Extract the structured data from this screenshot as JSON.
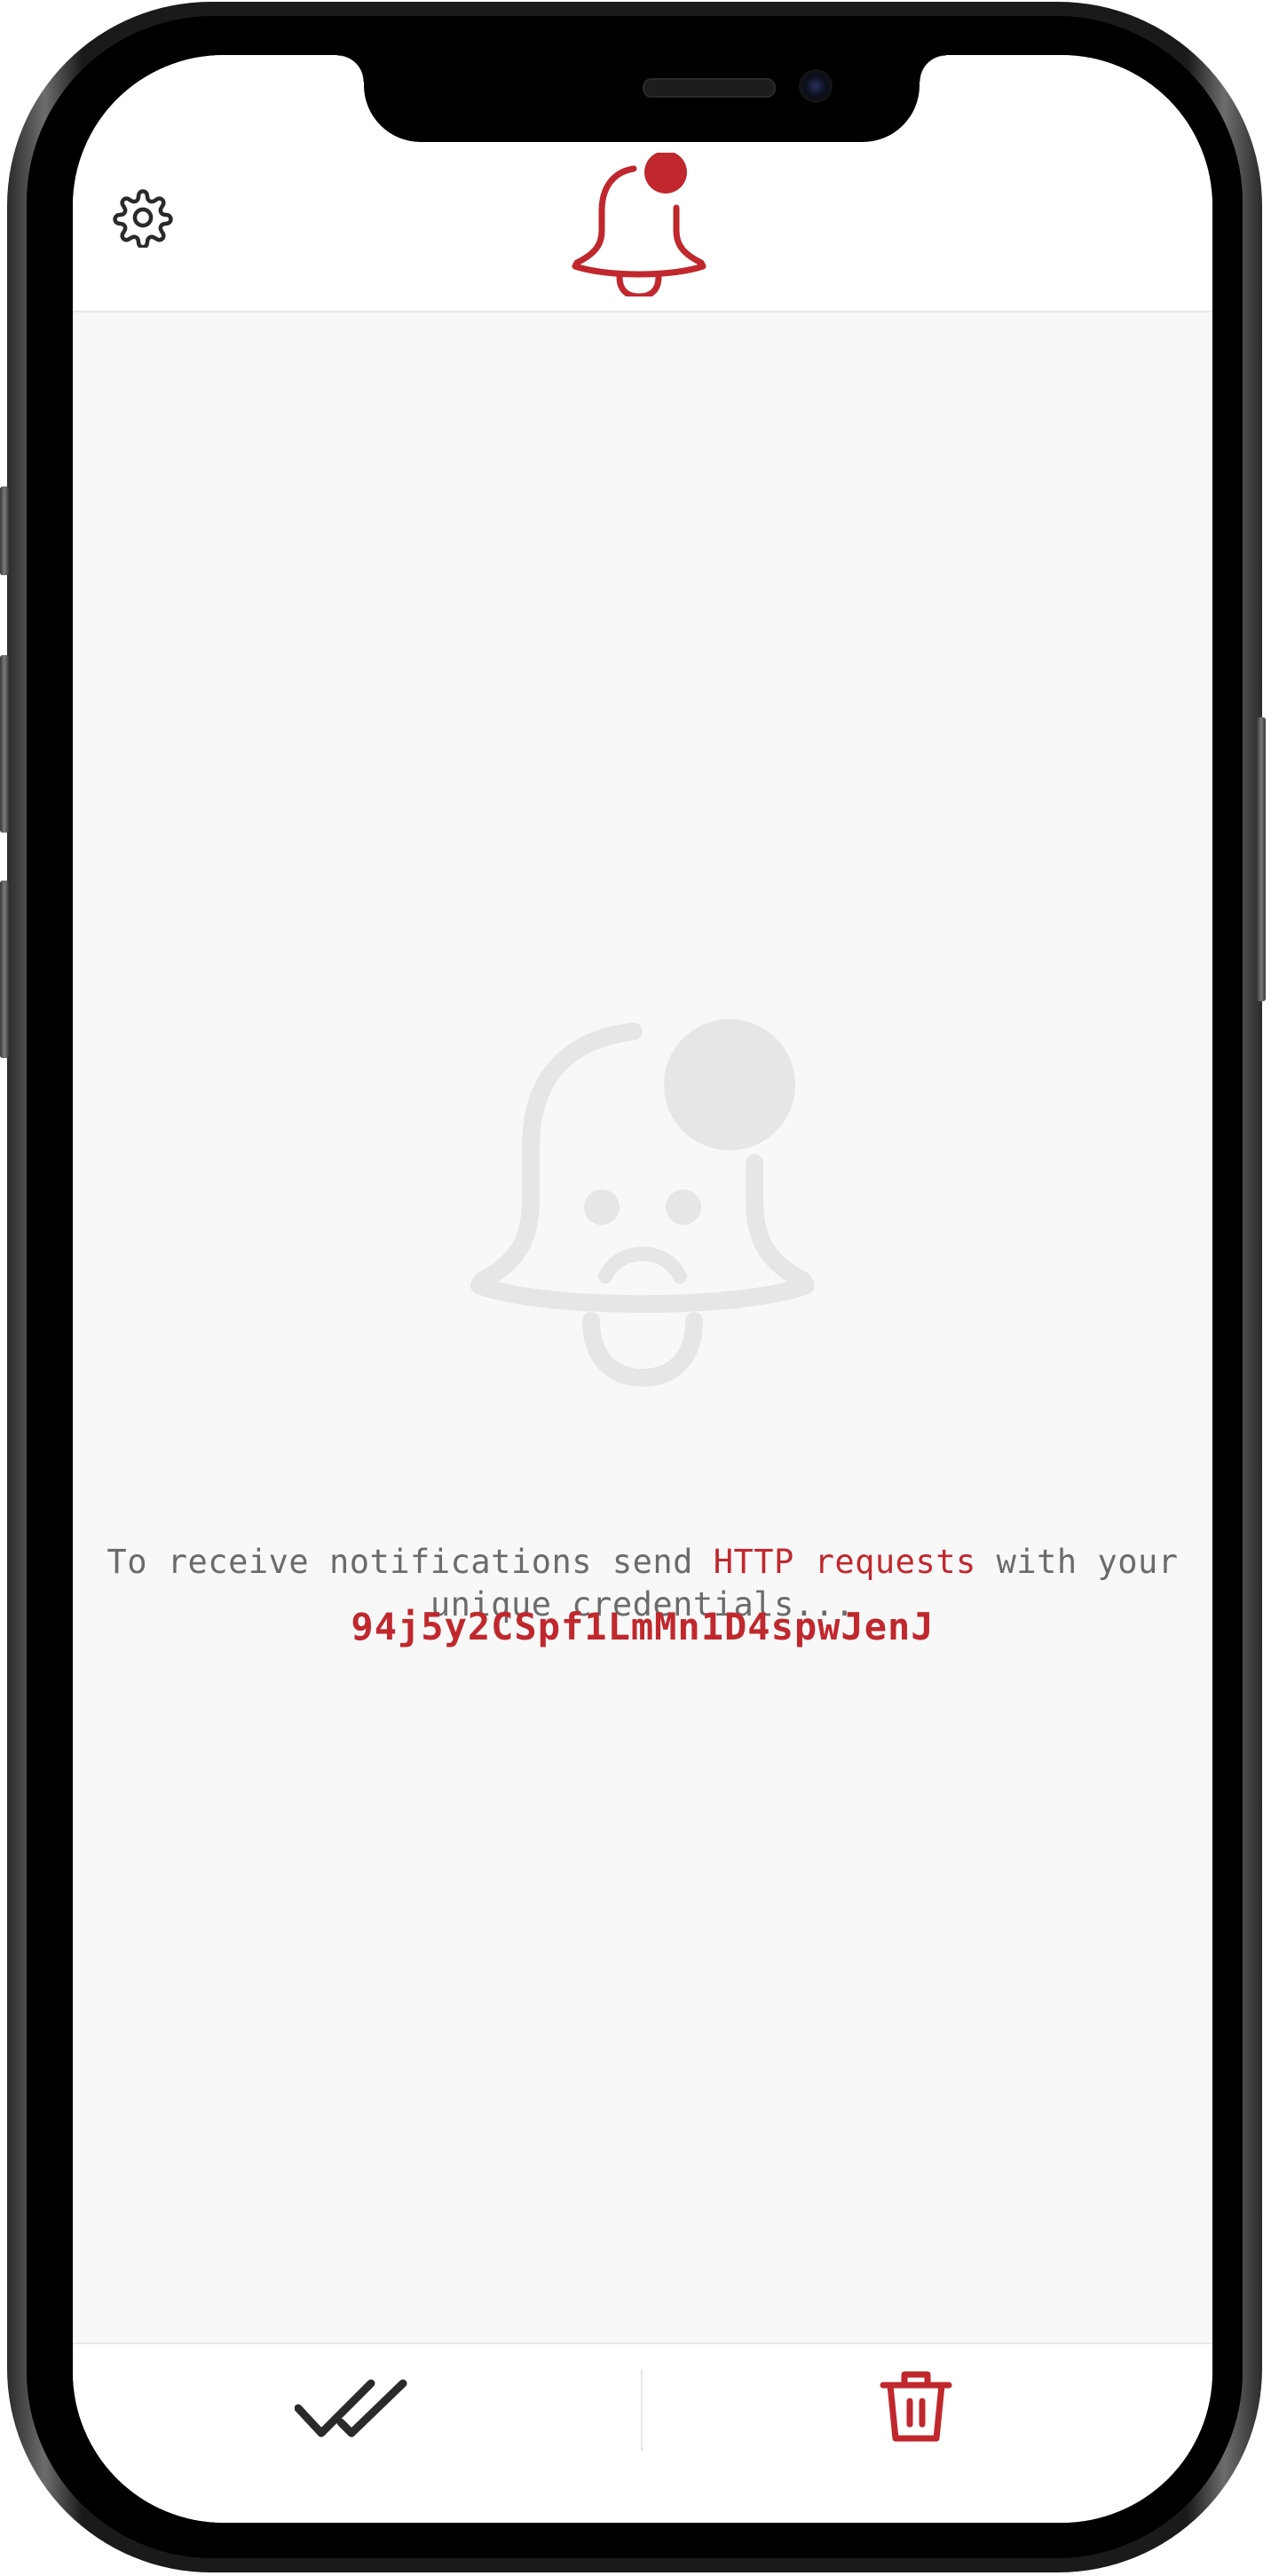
{
  "theme": {
    "accent": "#c0282d",
    "text_muted": "#6b6b6b",
    "background": "#f8f8f8",
    "placeholder_icon": "#e6e6e6"
  },
  "header": {
    "settings_icon": "gear-icon",
    "logo_icon": "bell-notification-icon"
  },
  "empty_state": {
    "illustration": "sad-bell-icon",
    "message_before": "To receive notifications send ",
    "message_highlight": "HTTP requests",
    "message_after": " with your unique credentials...",
    "credential": "94j5y2CSpf1LmMn1D4spwJenJ"
  },
  "footer": {
    "mark_all_read_icon": "double-check-icon",
    "delete_all_icon": "trash-icon"
  }
}
